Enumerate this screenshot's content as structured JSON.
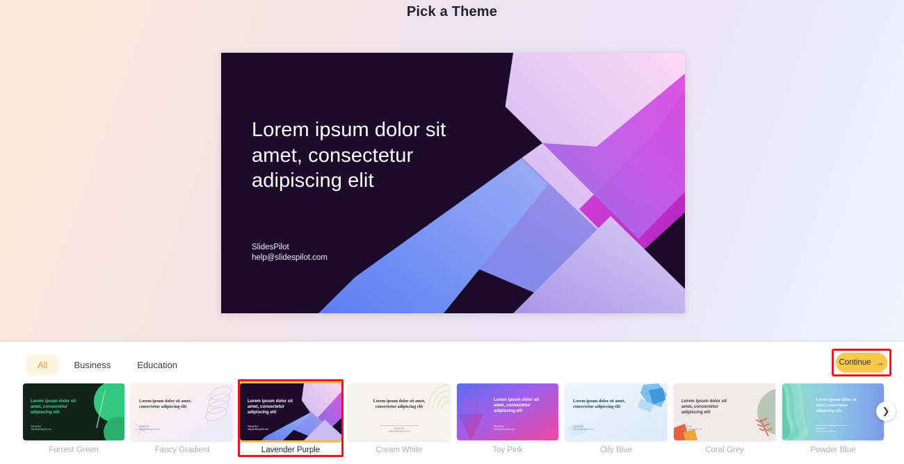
{
  "header": {
    "title": "Pick a Theme"
  },
  "preview": {
    "title": "Lorem ipsum dolor sit amet, consectetur adipiscing elit",
    "brand": "SlidesPilot",
    "email": "help@slidespilot.com",
    "theme": "Lavender Purple",
    "bg_color": "#1c0a2b"
  },
  "filters": {
    "tabs": [
      {
        "label": "All",
        "active": true
      },
      {
        "label": "Business",
        "active": false
      },
      {
        "label": "Education",
        "active": false
      }
    ]
  },
  "actions": {
    "continue_label": "Continue",
    "continue_arrow": "→",
    "continue_color": "#f7c948",
    "highlight_color": "#e8171b",
    "next_arrow": "❯"
  },
  "themes": [
    {
      "name": "Forrest Green",
      "selected": false,
      "body": "Lorem ipsum dolor sit amet, consectetur adipiscing elit",
      "brand": "SlidesPilot",
      "email": "help@slidespilot.com"
    },
    {
      "name": "Fancy Gradient",
      "selected": false,
      "body": "Lorem ipsum dolor sit amet, consectetur adipiscing elit",
      "brand": "SlidesPilot",
      "email": "help@slidespilot.com"
    },
    {
      "name": "Lavender Purple",
      "selected": true,
      "body": "Lorem ipsum dolor sit amet, consectetur adipiscing elit",
      "brand": "SlidesPilot",
      "email": "help@slidespilot.com"
    },
    {
      "name": "Cream White",
      "selected": false,
      "body": "Lorem ipsum dolor sit amet, consectetur adipiscing elit",
      "brand": "SlidesPilot",
      "email": "help@slidespilot.com"
    },
    {
      "name": "Toy Pink",
      "selected": false,
      "body": "Lorem ipsum dolor sit amet, consectetur adipiscing elit",
      "brand": "SlidesPilot",
      "email": "help@slidespilot.com"
    },
    {
      "name": "Oily Blue",
      "selected": false,
      "body": "Lorem ipsum dolor sit amet, consectetur adipiscing elit",
      "brand": "SlidesPilot",
      "email": "help@slidespilot.com"
    },
    {
      "name": "Coral Grey",
      "selected": false,
      "body": "Lorem ipsum dolor sit amet, consectetur adipiscing elit",
      "brand": "SlidesPilot",
      "email": "help@slidespilot.com"
    },
    {
      "name": "Powder Blue",
      "selected": false,
      "body": "Lorem ipsum dolor sit amet, consectetur adipiscing elit",
      "brand": "SlidesPilot",
      "email": "help@slidespilot.com"
    }
  ]
}
